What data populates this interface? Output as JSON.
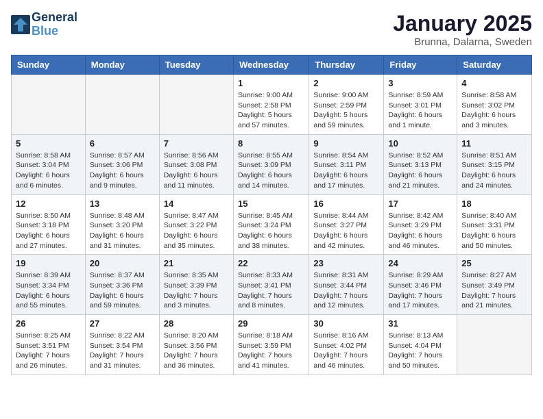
{
  "logo": {
    "line1": "General",
    "line2": "Blue"
  },
  "title": "January 2025",
  "location": "Brunna, Dalarna, Sweden",
  "days_of_week": [
    "Sunday",
    "Monday",
    "Tuesday",
    "Wednesday",
    "Thursday",
    "Friday",
    "Saturday"
  ],
  "weeks": [
    [
      {
        "num": "",
        "info": ""
      },
      {
        "num": "",
        "info": ""
      },
      {
        "num": "",
        "info": ""
      },
      {
        "num": "1",
        "info": "Sunrise: 9:00 AM\nSunset: 2:58 PM\nDaylight: 5 hours and 57 minutes."
      },
      {
        "num": "2",
        "info": "Sunrise: 9:00 AM\nSunset: 2:59 PM\nDaylight: 5 hours and 59 minutes."
      },
      {
        "num": "3",
        "info": "Sunrise: 8:59 AM\nSunset: 3:01 PM\nDaylight: 6 hours and 1 minute."
      },
      {
        "num": "4",
        "info": "Sunrise: 8:58 AM\nSunset: 3:02 PM\nDaylight: 6 hours and 3 minutes."
      }
    ],
    [
      {
        "num": "5",
        "info": "Sunrise: 8:58 AM\nSunset: 3:04 PM\nDaylight: 6 hours and 6 minutes."
      },
      {
        "num": "6",
        "info": "Sunrise: 8:57 AM\nSunset: 3:06 PM\nDaylight: 6 hours and 9 minutes."
      },
      {
        "num": "7",
        "info": "Sunrise: 8:56 AM\nSunset: 3:08 PM\nDaylight: 6 hours and 11 minutes."
      },
      {
        "num": "8",
        "info": "Sunrise: 8:55 AM\nSunset: 3:09 PM\nDaylight: 6 hours and 14 minutes."
      },
      {
        "num": "9",
        "info": "Sunrise: 8:54 AM\nSunset: 3:11 PM\nDaylight: 6 hours and 17 minutes."
      },
      {
        "num": "10",
        "info": "Sunrise: 8:52 AM\nSunset: 3:13 PM\nDaylight: 6 hours and 21 minutes."
      },
      {
        "num": "11",
        "info": "Sunrise: 8:51 AM\nSunset: 3:15 PM\nDaylight: 6 hours and 24 minutes."
      }
    ],
    [
      {
        "num": "12",
        "info": "Sunrise: 8:50 AM\nSunset: 3:18 PM\nDaylight: 6 hours and 27 minutes."
      },
      {
        "num": "13",
        "info": "Sunrise: 8:48 AM\nSunset: 3:20 PM\nDaylight: 6 hours and 31 minutes."
      },
      {
        "num": "14",
        "info": "Sunrise: 8:47 AM\nSunset: 3:22 PM\nDaylight: 6 hours and 35 minutes."
      },
      {
        "num": "15",
        "info": "Sunrise: 8:45 AM\nSunset: 3:24 PM\nDaylight: 6 hours and 38 minutes."
      },
      {
        "num": "16",
        "info": "Sunrise: 8:44 AM\nSunset: 3:27 PM\nDaylight: 6 hours and 42 minutes."
      },
      {
        "num": "17",
        "info": "Sunrise: 8:42 AM\nSunset: 3:29 PM\nDaylight: 6 hours and 46 minutes."
      },
      {
        "num": "18",
        "info": "Sunrise: 8:40 AM\nSunset: 3:31 PM\nDaylight: 6 hours and 50 minutes."
      }
    ],
    [
      {
        "num": "19",
        "info": "Sunrise: 8:39 AM\nSunset: 3:34 PM\nDaylight: 6 hours and 55 minutes."
      },
      {
        "num": "20",
        "info": "Sunrise: 8:37 AM\nSunset: 3:36 PM\nDaylight: 6 hours and 59 minutes."
      },
      {
        "num": "21",
        "info": "Sunrise: 8:35 AM\nSunset: 3:39 PM\nDaylight: 7 hours and 3 minutes."
      },
      {
        "num": "22",
        "info": "Sunrise: 8:33 AM\nSunset: 3:41 PM\nDaylight: 7 hours and 8 minutes."
      },
      {
        "num": "23",
        "info": "Sunrise: 8:31 AM\nSunset: 3:44 PM\nDaylight: 7 hours and 12 minutes."
      },
      {
        "num": "24",
        "info": "Sunrise: 8:29 AM\nSunset: 3:46 PM\nDaylight: 7 hours and 17 minutes."
      },
      {
        "num": "25",
        "info": "Sunrise: 8:27 AM\nSunset: 3:49 PM\nDaylight: 7 hours and 21 minutes."
      }
    ],
    [
      {
        "num": "26",
        "info": "Sunrise: 8:25 AM\nSunset: 3:51 PM\nDaylight: 7 hours and 26 minutes."
      },
      {
        "num": "27",
        "info": "Sunrise: 8:22 AM\nSunset: 3:54 PM\nDaylight: 7 hours and 31 minutes."
      },
      {
        "num": "28",
        "info": "Sunrise: 8:20 AM\nSunset: 3:56 PM\nDaylight: 7 hours and 36 minutes."
      },
      {
        "num": "29",
        "info": "Sunrise: 8:18 AM\nSunset: 3:59 PM\nDaylight: 7 hours and 41 minutes."
      },
      {
        "num": "30",
        "info": "Sunrise: 8:16 AM\nSunset: 4:02 PM\nDaylight: 7 hours and 46 minutes."
      },
      {
        "num": "31",
        "info": "Sunrise: 8:13 AM\nSunset: 4:04 PM\nDaylight: 7 hours and 50 minutes."
      },
      {
        "num": "",
        "info": ""
      }
    ]
  ]
}
